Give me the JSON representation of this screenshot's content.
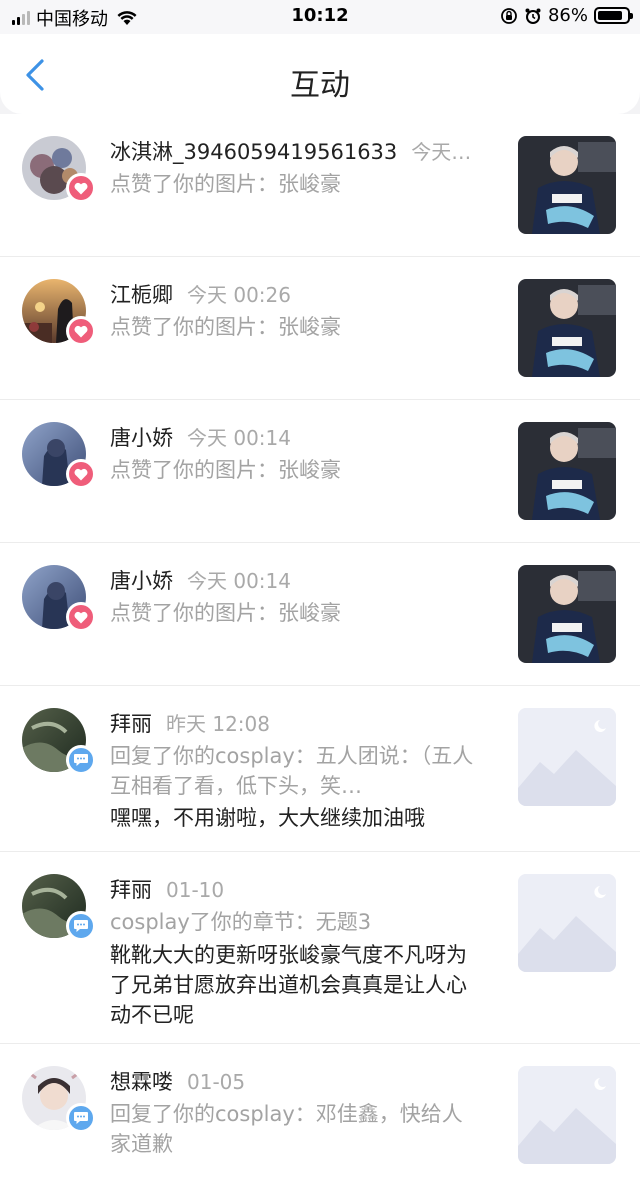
{
  "status_bar": {
    "carrier": "中国移动",
    "time": "10:12",
    "battery": "86%",
    "battery_level": 0.86
  },
  "header": {
    "title": "互动"
  },
  "items": [
    {
      "name": "冰淇淋_3946059419561633",
      "time": "今天…",
      "action": "点赞了你的图片：张峻豪",
      "type": "like"
    },
    {
      "name": "江栀卿",
      "time": "今天 00:26",
      "action": "点赞了你的图片：张峻豪",
      "type": "like"
    },
    {
      "name": "唐小娇",
      "time": "今天 00:14",
      "action": "点赞了你的图片：张峻豪",
      "type": "like"
    },
    {
      "name": "唐小娇",
      "time": "今天 00:14",
      "action": "点赞了你的图片：张峻豪",
      "type": "like"
    },
    {
      "name": "拜丽",
      "time": "昨天 12:08",
      "action": "回复了你的cosplay：五人团说：（五人互相看了看，低下头，笑…",
      "content": "嘿嘿，不用谢啦，大大继续加油哦",
      "type": "reply"
    },
    {
      "name": "拜丽",
      "time": "01-10",
      "action": "cosplay了你的章节：无题3",
      "content": "靴靴大大的更新呀张峻豪气度不凡呀为了兄弟甘愿放弃出道机会真真是让人心动不已呢",
      "type": "reply"
    },
    {
      "name": "想霖喽",
      "time": "01-05",
      "action": "回复了你的cosplay：邓佳鑫，快给人家道歉",
      "type": "reply"
    }
  ]
}
